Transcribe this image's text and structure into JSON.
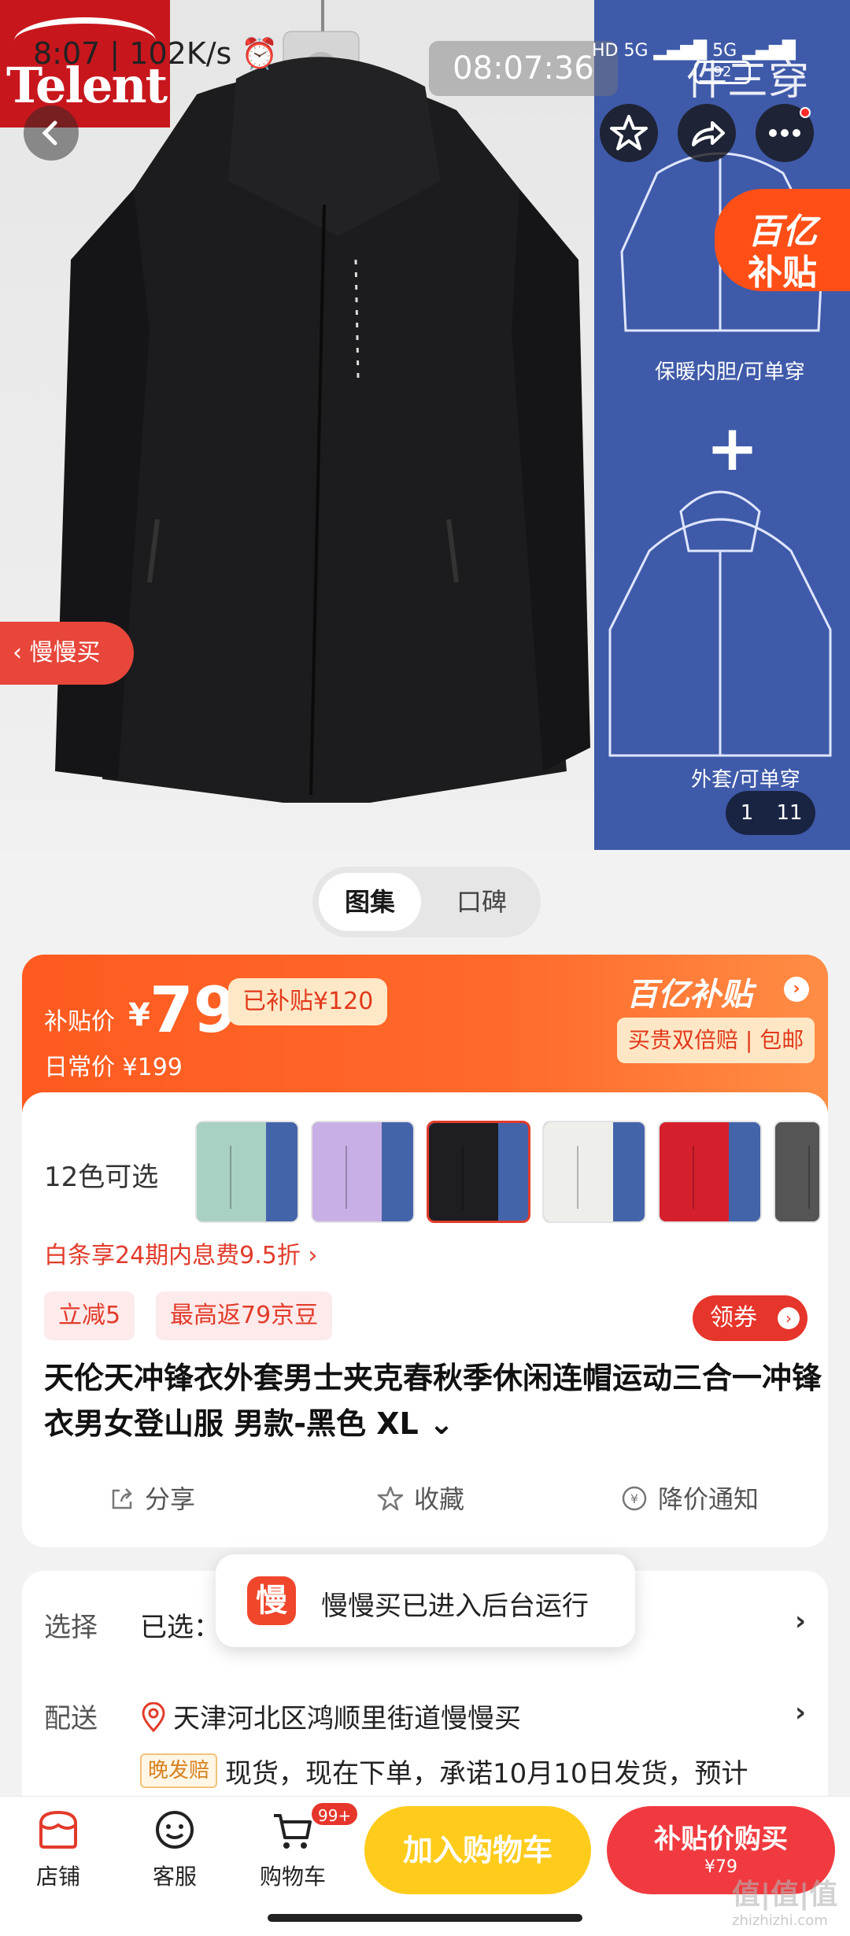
{
  "status_bar": {
    "left": "8:07 | 102K/s ⏰",
    "center_time": "08:07:36",
    "network": "HD 5G ▂▄▆█ 5G ▂▄▆█",
    "battery": "92"
  },
  "gallery": {
    "brand_logo_text": "Telent",
    "side_title": "件三穿",
    "subsidy_badge": {
      "line1": "百亿",
      "line2": "补贴"
    },
    "caption_inner": "保暖内胆/可单穿",
    "caption_outer": "外套/可单穿",
    "plus": "+",
    "slow_tag": "慢慢买",
    "counter_current": "1",
    "counter_total": "11",
    "colors": {
      "jacket": "#1c1c1e",
      "side_panel": "#3f5aa9"
    }
  },
  "tabs": [
    {
      "label": "图集"
    },
    {
      "label": "口碑"
    }
  ],
  "price_banner": {
    "label": "补贴价",
    "currency": "¥",
    "price": "79",
    "saved": "已补贴¥120",
    "daily_price": "日常价 ¥199",
    "brand": "百亿补贴",
    "guarantee": "买贵双倍赔 | 包邮"
  },
  "product": {
    "color_count": "12色可选",
    "swatches": [
      {
        "color": "#a8d1c3"
      },
      {
        "color": "#c8b0e6"
      },
      {
        "color": "#1e1e22",
        "selected": true
      },
      {
        "color": "#eeefeb"
      },
      {
        "color": "#d61f2c"
      },
      {
        "color": "#555"
      }
    ],
    "baitiao": "白条享24期内息费9.5折 ›",
    "chip_instant": "立减5",
    "chip_beans": "最高返79京豆",
    "coupon": "领券",
    "title": "天伦天冲锋衣外套男士夹克春秋季休闲连帽运动三合一冲锋衣男女登山服 男款-黑色 XL ⌄",
    "actions": {
      "share": "分享",
      "favorite": "收藏",
      "price_alert": "降价通知"
    }
  },
  "select_row": {
    "label": "选择",
    "value": "已选：",
    "chevron": "›"
  },
  "delivery_row": {
    "label": "配送",
    "address": "天津河北区鸿顺里街道慢慢买",
    "chevron": "›",
    "late_tag": "晚发赔",
    "promise": "现货，现在下单，承诺10月10日发货，预计"
  },
  "toast": {
    "icon_char": "慢",
    "text": "慢慢买已进入后台运行"
  },
  "bottom_bar": {
    "shop": "店铺",
    "service": "客服",
    "cart": "购物车",
    "cart_badge": "99+",
    "add_to_cart": "加入购物车",
    "buy_label": "补贴价购买",
    "buy_price": "¥79"
  },
  "watermark": {
    "text": "值|值|值",
    "url": "zhizhizhi.com"
  }
}
